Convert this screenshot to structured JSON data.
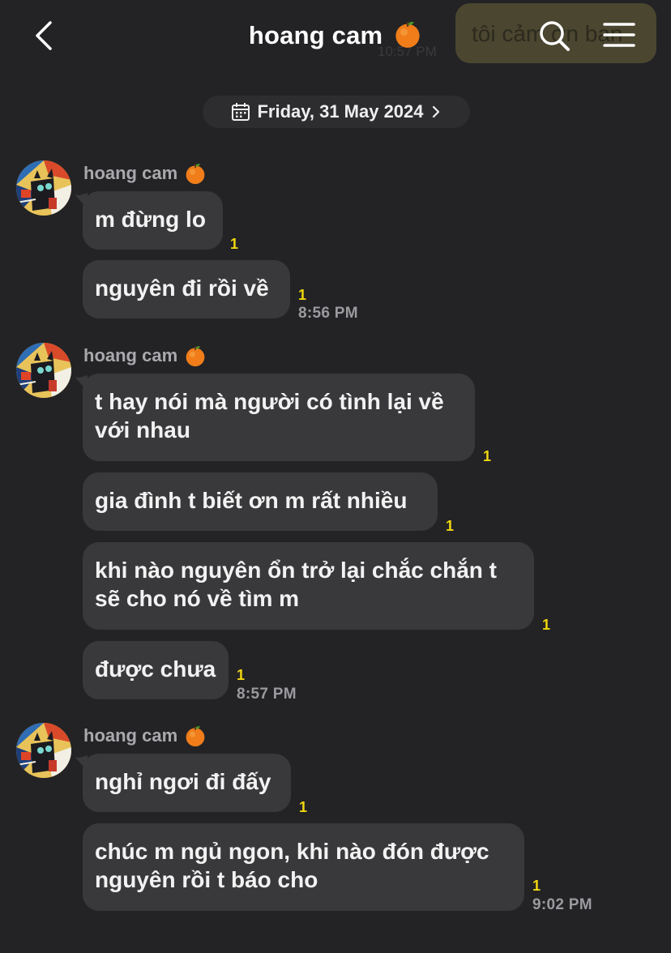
{
  "header": {
    "title": "hoang cam",
    "title_emoji": "orange-emoji",
    "behind_text": "tôi cảm ơn bạn",
    "behind_time": "10:57 PM"
  },
  "date_separator": {
    "label": "Friday, 31 May 2024"
  },
  "groups": [
    {
      "sender": "hoang cam",
      "messages": [
        {
          "text": "m đừng lo",
          "unread": "1"
        },
        {
          "text": "nguyên đi rồi về",
          "unread": "1",
          "time": "8:56 PM"
        }
      ]
    },
    {
      "sender": "hoang cam",
      "messages": [
        {
          "text": "t hay nói mà người có tình lại về với nhau",
          "unread": "1"
        },
        {
          "text": "gia đình t biết ơn m rất nhiều",
          "unread": "1"
        },
        {
          "text": "khi nào nguyên ổn trở lại chắc chắn t sẽ cho nó về tìm m",
          "unread": "1"
        },
        {
          "text": "được chưa",
          "unread": "1",
          "time": "8:57 PM"
        }
      ]
    },
    {
      "sender": "hoang cam",
      "messages": [
        {
          "text": "nghỉ ngơi đi đấy",
          "unread": "1"
        },
        {
          "text": "chúc m ngủ ngon, khi nào đón được nguyên rồi t báo cho",
          "unread": "1",
          "time": "9:02 PM"
        }
      ]
    }
  ],
  "colors": {
    "background": "#232325",
    "bubble": "#39393c",
    "unread_count": "#f1d60f",
    "timestamp": "#9a9a9f"
  }
}
